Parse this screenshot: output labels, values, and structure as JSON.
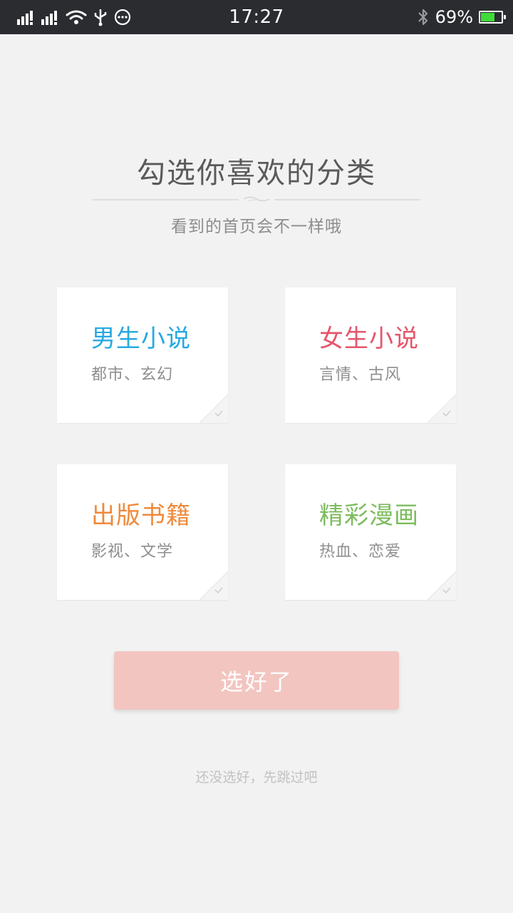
{
  "status_bar": {
    "time": "17:27",
    "battery_text": "69%",
    "battery_level": 0.69,
    "icons": [
      "signal-icon",
      "signal-icon",
      "wifi-icon",
      "usb-icon",
      "more-icon",
      "bluetooth-icon",
      "battery-icon"
    ],
    "battery_color": "#3fdc3a"
  },
  "header": {
    "title": "勾选你喜欢的分类",
    "subtitle": "看到的首页会不一样哦"
  },
  "categories": [
    {
      "title": "男生小说",
      "subtitle": "都市、玄幻",
      "color": "#27a9e1"
    },
    {
      "title": "女生小说",
      "subtitle": "言情、古风",
      "color": "#e5566b"
    },
    {
      "title": "出版书籍",
      "subtitle": "影视、文学",
      "color": "#ef8a3b"
    },
    {
      "title": "精彩漫画",
      "subtitle": "热血、恋爱",
      "color": "#7dbc5e"
    }
  ],
  "actions": {
    "confirm_label": "选好了",
    "skip_label": "还没选好，先跳过吧"
  },
  "colors": {
    "background": "#f2f2f2",
    "status_bar": "#2b2c30",
    "confirm_button": "#f2c5c1"
  }
}
